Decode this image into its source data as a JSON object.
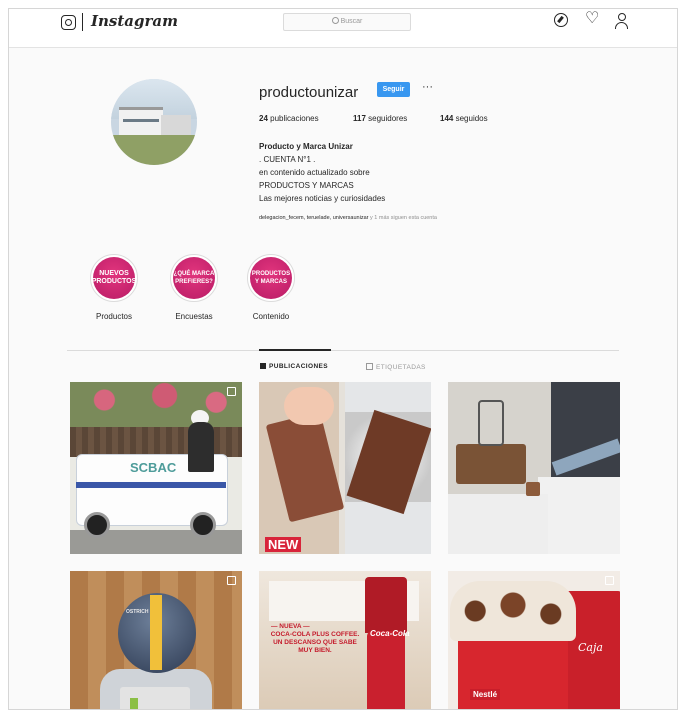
{
  "topbar": {
    "logo_text": "Instagram",
    "search_placeholder": "Buscar",
    "icons": [
      "instagram-glyph-icon",
      "compass-icon",
      "heart-icon",
      "profile-icon"
    ]
  },
  "profile": {
    "username": "productounizar",
    "follow_label": "Seguir",
    "more_label": "···",
    "stats": {
      "posts_count": "24",
      "posts_label": "publicaciones",
      "followers_count": "117",
      "followers_label": "seguidores",
      "following_count": "144",
      "following_label": "seguidos"
    },
    "bio": {
      "name": "Producto y Marca Unizar",
      "line1": ". CUENTA N°1 .",
      "line2": "en contenido actualizado sobre",
      "line3": "PRODUCTOS Y MARCAS",
      "line4": "Las mejores noticias y curiosidades"
    },
    "followed_by": {
      "names": "delegacion_fecem, teruelade, universaunizar",
      "rest": " y 1 más siguen esta cuenta"
    }
  },
  "highlights": [
    {
      "label": "Productos",
      "cover_text": "NUEVOS PRODUCTOS"
    },
    {
      "label": "Encuestas",
      "cover_text": "¿QUÉ MARCA PREFIERES?"
    },
    {
      "label": "Contenido",
      "cover_text": "PRODUCTOS Y MARCAS"
    }
  ],
  "tabs": {
    "posts": "PUBLICACIONES",
    "tagged": "ETIQUETADAS"
  },
  "posts": {
    "p1_text": "SCBAC",
    "p2_text": "NEW",
    "p4_text": "OSTRICH",
    "p5_line1": "— NUEVA —",
    "p5_line2": "COCA-COLA PLUS COFFEE. UN DESCANSO QUE SABE MUY BIEN.",
    "p5_can": "Coca-Cola",
    "p6_brand": "Nestlé",
    "p6_cup": "Caja"
  },
  "colors": {
    "follow_button": "#3897f0",
    "highlight_pink": "#c41f6c",
    "coca_cola_red": "#c9202e"
  }
}
